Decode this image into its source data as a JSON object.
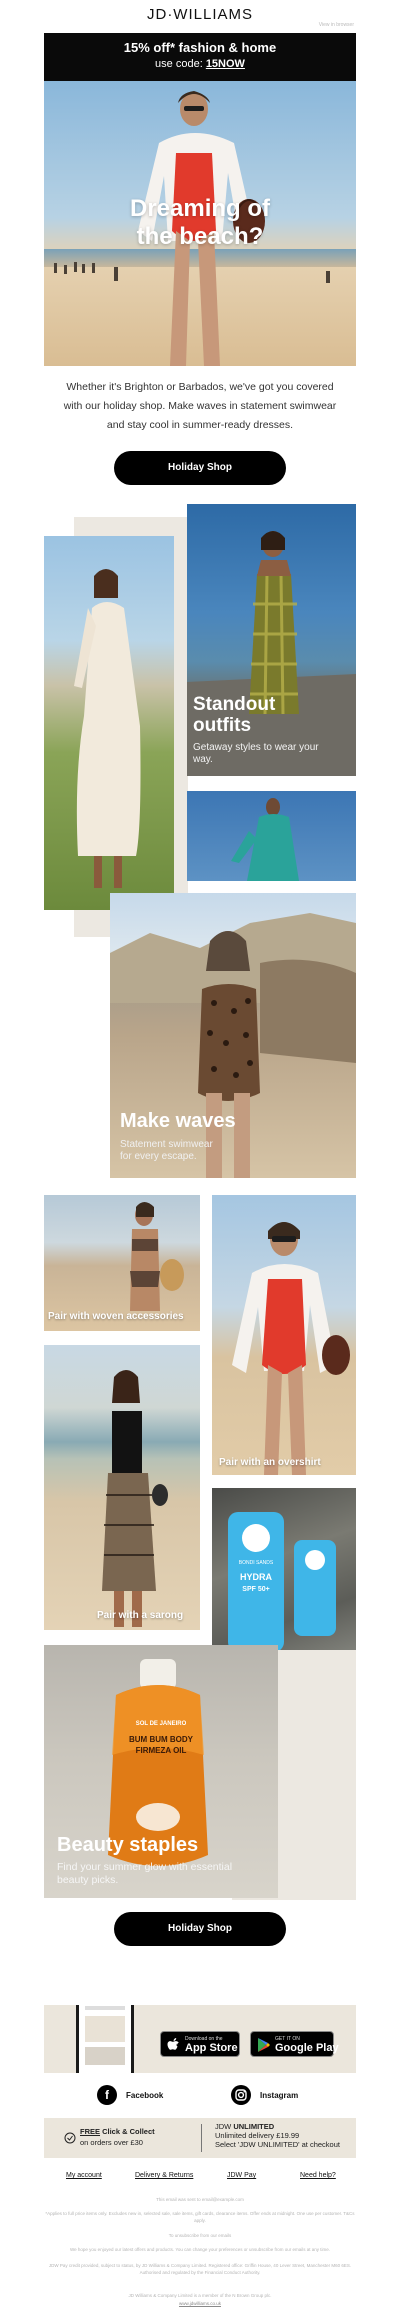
{
  "header": {
    "brand": "JD·WILLIAMS",
    "view_in_browser": "View in browser"
  },
  "promo": {
    "headline": "15% off* fashion & home",
    "code_prefix": "use code: ",
    "code": "15NOW"
  },
  "hero": {
    "title_line1": "Dreaming of",
    "title_line2": "the beach?"
  },
  "intro": {
    "text": "Whether it's Brighton or Barbados, we've got you covered with our holiday shop. Make waves in statement swimwear and stay cool in summer-ready dresses."
  },
  "cta": {
    "holiday_shop_1": "Holiday Shop",
    "holiday_shop_2": "Holiday Shop"
  },
  "collage1": {
    "standout_title_1": "Standout",
    "standout_title_2": "outfits",
    "standout_sub": "Getaway styles to wear your way.",
    "waves_title": "Make waves",
    "waves_sub_1": "Statement swimwear",
    "waves_sub_2": "for every escape."
  },
  "collage2": {
    "woven_caption": "Pair with woven accessories",
    "overshirt_caption": "Pair with an overshirt",
    "sarong_caption": "Pair with a sarong",
    "beauty_title": "Beauty staples",
    "beauty_sub": "Find your summer glow with essential beauty picks."
  },
  "products": {
    "oil_label_1": "BUM BUM BODY",
    "oil_label_2": "FIRMEZA OIL",
    "oil_brand": "SOL DE JANEIRO",
    "sunscreen_brand": "BONDI SANDS",
    "sunscreen_name": "HYDRA",
    "sunscreen_spf": "SPF 50+"
  },
  "app": {
    "appstore_small": "Download on the",
    "appstore_big": "App Store",
    "gplay_small": "GET IT ON",
    "gplay_big": "Google Play"
  },
  "social": {
    "facebook": "Facebook",
    "instagram": "Instagram"
  },
  "delivery": {
    "cc_bold": "FREE",
    "cc_rest": " Click & Collect",
    "cc_sub": "on orders over £30",
    "unl_brand": "JDW",
    "unl_title": "UNLIMITED",
    "unl_line1": "Unlimited delivery £19.99",
    "unl_line2": "Select 'JDW UNLIMITED' at checkout"
  },
  "footer": {
    "link_account": "My account",
    "link_delivery": "Delivery & Returns",
    "link_pay": "JDW Pay",
    "link_help": "Need help?",
    "fine1": "This email was sent to email@example.com",
    "fine2": "*Applies to full price items only. Excludes new in, selected sale, sale items, gift cards, clearance items. Offer ends at midnight. One use per customer. T&Cs apply.",
    "fine3": "To unsubscribe from our emails",
    "fine4": "We hope you enjoyed our latest offers and products. You can change your preferences or unsubscribe from our emails at any time.",
    "fine5": "JDW Pay credit provided, subject to status, by JD Williams & Company Limited. Registered office: Griffin House, 40 Lever Street, Manchester M60 6ES. Authorised and regulated by the Financial Conduct Authority.",
    "fine6": "JD Williams & Company Limited is a member of the N Brown Group plc.",
    "fine7": "www.jdwilliams.co.uk"
  }
}
